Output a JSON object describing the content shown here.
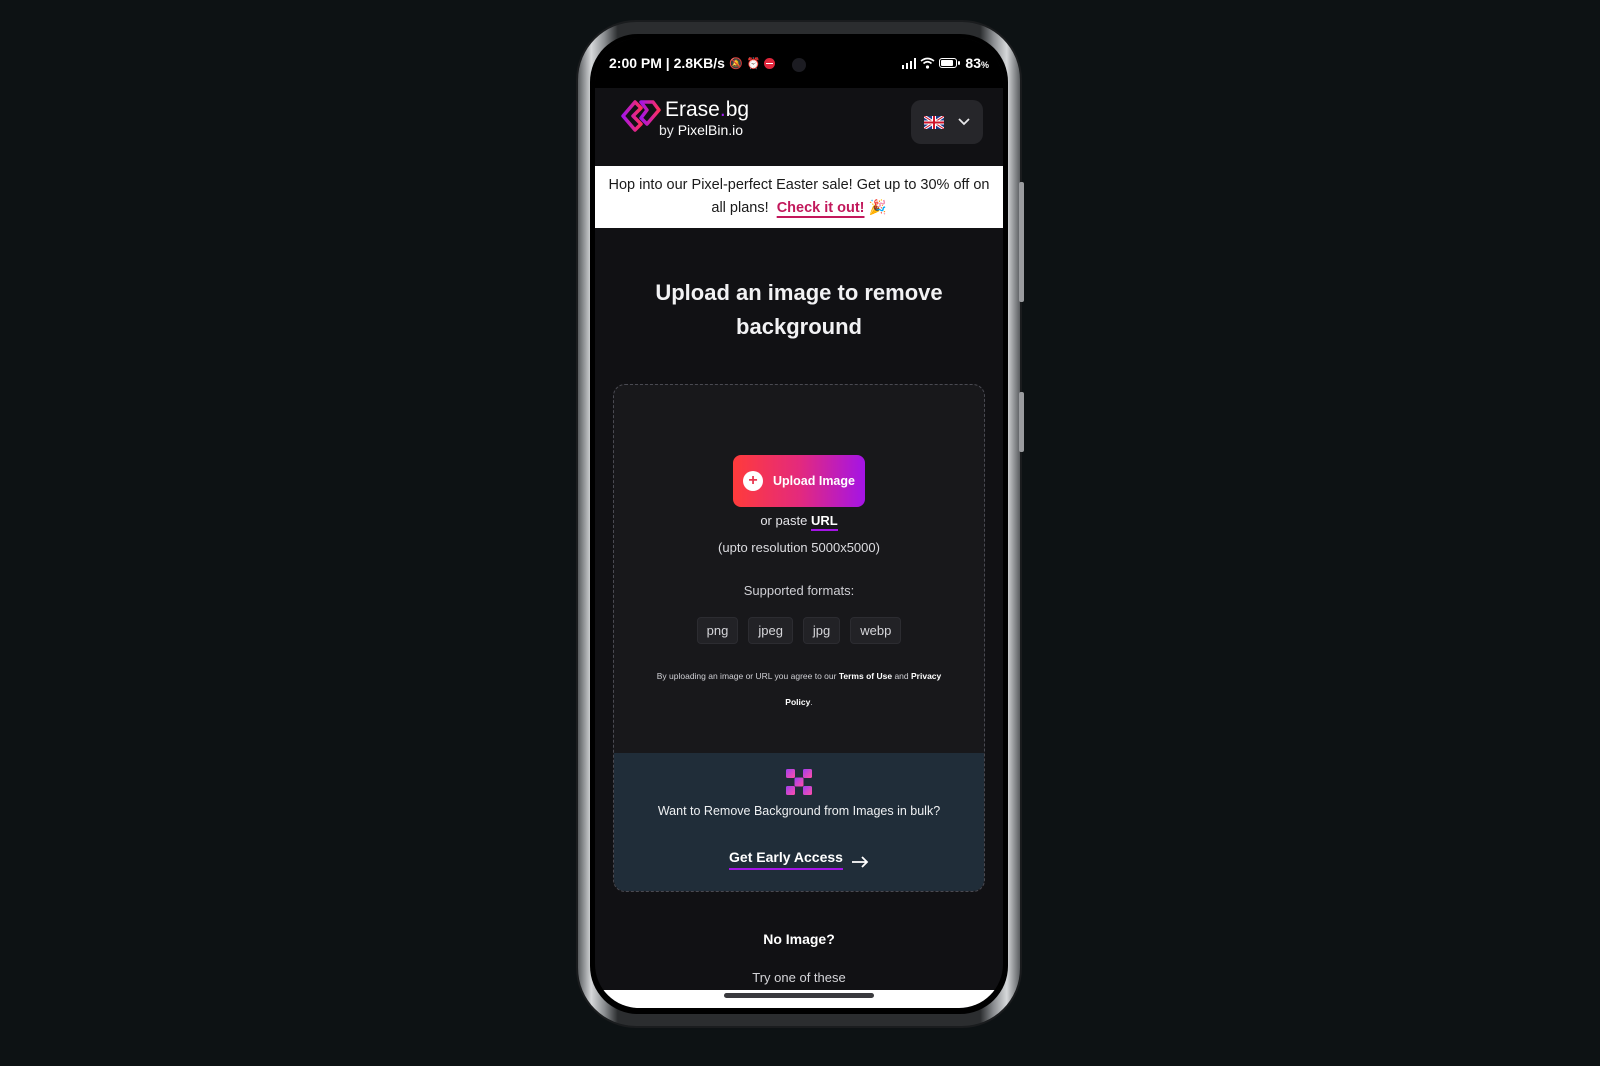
{
  "status_bar": {
    "time_speed": "2:00 PM | 2.8KB/s",
    "battery_percent": "83",
    "battery_suffix": "%",
    "icons": [
      "mute-bell-icon",
      "alarm-icon",
      "do-not-disturb-icon",
      "signal-icon",
      "wifi-icon",
      "battery-icon"
    ]
  },
  "header": {
    "logo_name_part1": "Erase",
    "logo_name_dot": ".",
    "logo_name_part2": "bg",
    "logo_by": "by",
    "logo_by_brand": "PixelBin.io",
    "language": {
      "flag": "uk-flag-icon",
      "icon": "chevron-down-icon"
    }
  },
  "promo": {
    "text": "Hop into our Pixel-perfect Easter sale! Get up to 30% off on all plans!",
    "link_label": "Check it out!",
    "emoji": "🎉"
  },
  "main": {
    "title": "Upload an image to remove background",
    "upload_button_label": "Upload Image",
    "paste_prefix": "or paste",
    "paste_link": "URL",
    "resolution_note": "(upto resolution 5000x5000)",
    "formats_label": "Supported formats:",
    "formats": [
      "png",
      "jpeg",
      "jpg",
      "webp"
    ],
    "terms_prefix": "By uploading an image or URL you agree to our",
    "terms_link": "Terms of Use",
    "terms_and": "and",
    "privacy_link": "Privacy Policy",
    "terms_suffix": "."
  },
  "bulk": {
    "text": "Want to Remove Background from Images in bulk?",
    "cta_label": "Get Early Access"
  },
  "footer_section": {
    "heading": "No Image?",
    "subheading": "Try one of these"
  },
  "colors": {
    "accent_purple": "#a414e6",
    "gradient_start": "#ff3b3b",
    "promo_link": "#c2185b",
    "bulk_bg": "#202d39"
  }
}
